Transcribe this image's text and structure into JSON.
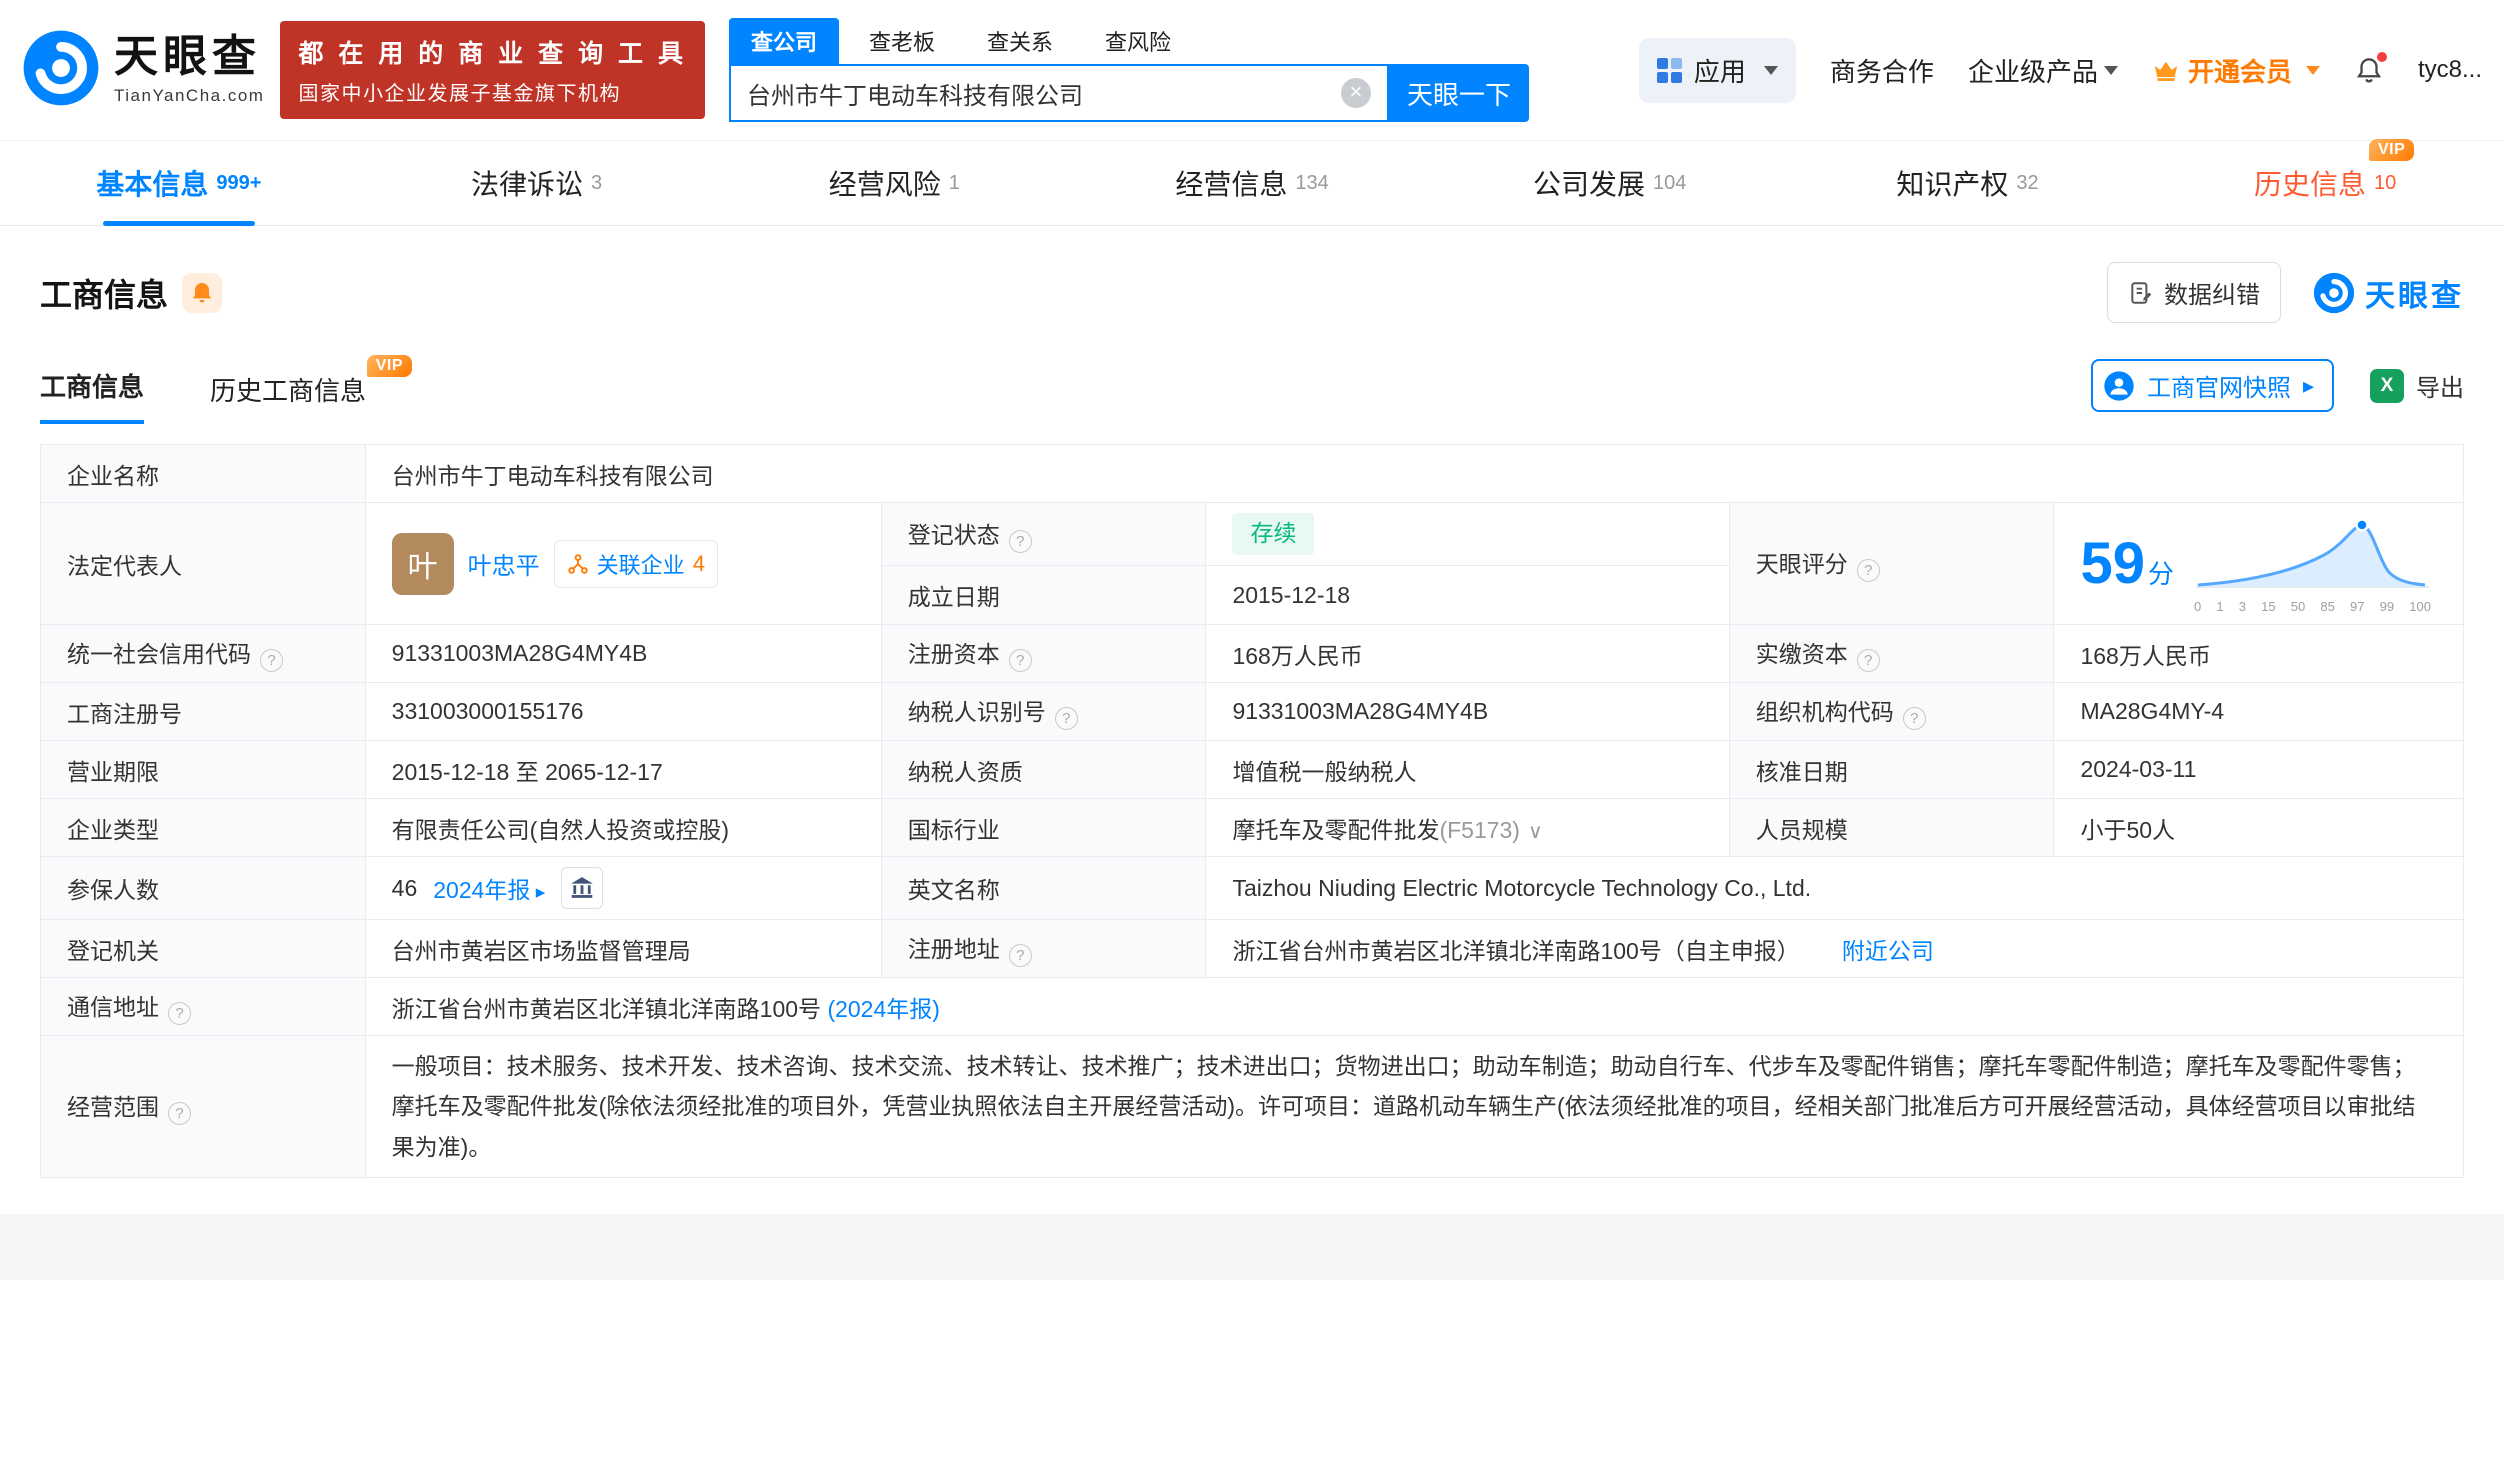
{
  "vip_label": "VIP",
  "colors": {
    "brand_blue": "#0084ff",
    "vip_orange": "#ff7a00",
    "history_orange": "#ff5b33",
    "status_green": "#09b87d",
    "promo_red": "#c03327"
  },
  "header": {
    "logo": {
      "brand": "天眼查",
      "domain": "TianYanCha.com"
    },
    "promo": {
      "line1": "都 在 用 的 商 业 查 询 工 具",
      "line2": "国家中小企业发展子基金旗下机构"
    },
    "search_tabs": [
      {
        "label": "查公司"
      },
      {
        "label": "查老板"
      },
      {
        "label": "查关系"
      },
      {
        "label": "查风险"
      }
    ],
    "search": {
      "value": "台州市牛丁电动车科技有限公司",
      "button_label": "天眼一下"
    },
    "nav": {
      "apps": "应用",
      "biz_coop": "商务合作",
      "enterprise": "企业级产品",
      "vip": "开通会员",
      "user": "tyc8..."
    }
  },
  "nav_tabs": [
    {
      "label": "基本信息",
      "count": "999+"
    },
    {
      "label": "法律诉讼",
      "count": "3"
    },
    {
      "label": "经营风险",
      "count": "1"
    },
    {
      "label": "经营信息",
      "count": "134"
    },
    {
      "label": "公司发展",
      "count": "104"
    },
    {
      "label": "知识产权",
      "count": "32"
    },
    {
      "label": "历史信息",
      "count": "10"
    }
  ],
  "section": {
    "title": "工商信息",
    "data_correction": "数据纠错",
    "brand": "天眼查",
    "subtabs": [
      {
        "label": "工商信息"
      },
      {
        "label": "历史工商信息"
      }
    ],
    "snapshot": "工商官网快照",
    "export": "导出"
  },
  "fields": {
    "company_name": {
      "label": "企业名称",
      "value": "台州市牛丁电动车科技有限公司"
    },
    "legal_rep": {
      "label": "法定代表人",
      "avatar": "叶",
      "name": "叶忠平",
      "related_label": "关联企业",
      "related_count": "4"
    },
    "reg_status": {
      "label": "登记状态",
      "value": "存续"
    },
    "establish_date": {
      "label": "成立日期",
      "value": "2015-12-18"
    },
    "score": {
      "label": "天眼评分",
      "value": "59",
      "unit": "分",
      "axis": [
        "0",
        "1",
        "3",
        "15",
        "50",
        "85",
        "97",
        "99",
        "100"
      ]
    },
    "credit_code": {
      "label": "统一社会信用代码",
      "value": "91331003MA28G4MY4B"
    },
    "reg_capital": {
      "label": "注册资本",
      "value": "168万人民币"
    },
    "paid_capital": {
      "label": "实缴资本",
      "value": "168万人民币"
    },
    "reg_number": {
      "label": "工商注册号",
      "value": "331003000155176"
    },
    "taxpayer_id": {
      "label": "纳税人识别号",
      "value": "91331003MA28G4MY4B"
    },
    "org_code": {
      "label": "组织机构代码",
      "value": "MA28G4MY-4"
    },
    "business_term": {
      "label": "营业期限",
      "value": "2015-12-18 至 2065-12-17"
    },
    "taxpayer_quality": {
      "label": "纳税人资质",
      "value": "增值税一般纳税人"
    },
    "approval_date": {
      "label": "核准日期",
      "value": "2024-03-11"
    },
    "company_type": {
      "label": "企业类型",
      "value": "有限责任公司(自然人投资或控股)"
    },
    "industry": {
      "label": "国标行业",
      "value": "摩托车及零配件批发",
      "code": "(F5173)"
    },
    "staff_size": {
      "label": "人员规模",
      "value": "小于50人"
    },
    "insured": {
      "label": "参保人数",
      "value": "46",
      "report": "2024年报"
    },
    "english_name": {
      "label": "英文名称",
      "value": "Taizhou Niuding Electric Motorcycle Technology Co., Ltd."
    },
    "reg_authority": {
      "label": "登记机关",
      "value": "台州市黄岩区市场监督管理局"
    },
    "reg_address": {
      "label": "注册地址",
      "value": "浙江省台州市黄岩区北洋镇北洋南路100号（自主申报）",
      "link": "附近公司"
    },
    "mail_address": {
      "label": "通信地址",
      "value": "浙江省台州市黄岩区北洋镇北洋南路100号",
      "link": "(2024年报)"
    },
    "business_scope": {
      "label": "经营范围",
      "value": "一般项目：技术服务、技术开发、技术咨询、技术交流、技术转让、技术推广；技术进出口；货物进出口；助动车制造；助动自行车、代步车及零配件销售；摩托车零配件制造；摩托车及零配件零售；摩托车及零配件批发(除依法须经批准的项目外，凭营业执照依法自主开展经营活动)。许可项目：道路机动车辆生产(依法须经批准的项目，经相关部门批准后方可开展经营活动，具体经营项目以审批结果为准)。"
    }
  }
}
